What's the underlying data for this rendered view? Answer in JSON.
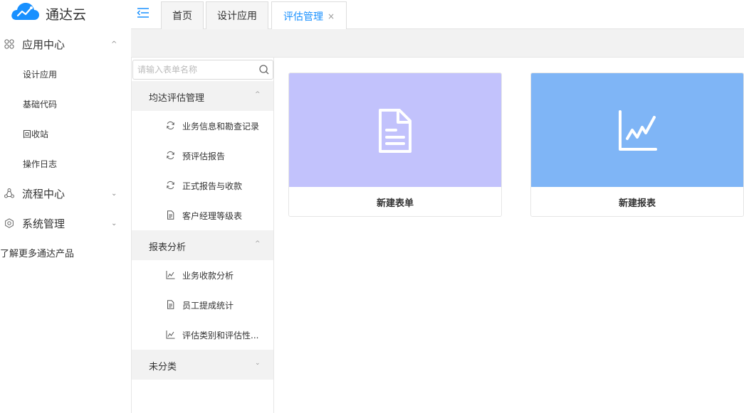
{
  "app": {
    "name": "通达云",
    "logo_color": "#1890ff"
  },
  "sidebar": {
    "groups": [
      {
        "label": "应用中心",
        "icon": "grid-icon",
        "expanded": true,
        "items": [
          {
            "label": "设计应用"
          },
          {
            "label": "基础代码"
          },
          {
            "label": "回收站"
          },
          {
            "label": "操作日志"
          }
        ]
      },
      {
        "label": "流程中心",
        "icon": "flow-icon",
        "expanded": false,
        "items": []
      },
      {
        "label": "系统管理",
        "icon": "settings-icon",
        "expanded": false,
        "items": []
      }
    ],
    "more_link": "了解更多通达产品"
  },
  "tabs": [
    {
      "label": "首页",
      "active": false,
      "closable": false
    },
    {
      "label": "设计应用",
      "active": false,
      "closable": false
    },
    {
      "label": "评估管理",
      "active": true,
      "closable": true,
      "close_glyph": "×"
    }
  ],
  "form_tree": {
    "search_placeholder": "请输入表单名称",
    "groups": [
      {
        "label": "均达评估管理",
        "expanded": true,
        "items": [
          {
            "label": "业务信息和勘查记录",
            "icon": "refresh-icon"
          },
          {
            "label": "预评估报告",
            "icon": "refresh-icon"
          },
          {
            "label": "正式报告与收款",
            "icon": "refresh-icon"
          },
          {
            "label": "客户经理等级表",
            "icon": "document-icon"
          }
        ]
      },
      {
        "label": "报表分析",
        "expanded": true,
        "items": [
          {
            "label": "业务收款分析",
            "icon": "chart-icon"
          },
          {
            "label": "员工提成统计",
            "icon": "document-icon"
          },
          {
            "label": "评估类别和评估性...",
            "icon": "chart-icon"
          }
        ]
      },
      {
        "label": "未分类",
        "expanded": false,
        "items": []
      }
    ]
  },
  "cards": [
    {
      "label": "新建表单",
      "icon": "form-document-icon",
      "color": "#c2c2fc"
    },
    {
      "label": "新建报表",
      "icon": "line-chart-icon",
      "color": "#7fb5f6"
    }
  ],
  "glyphs": {
    "arrow_up": "^",
    "arrow_down": "⌄"
  }
}
